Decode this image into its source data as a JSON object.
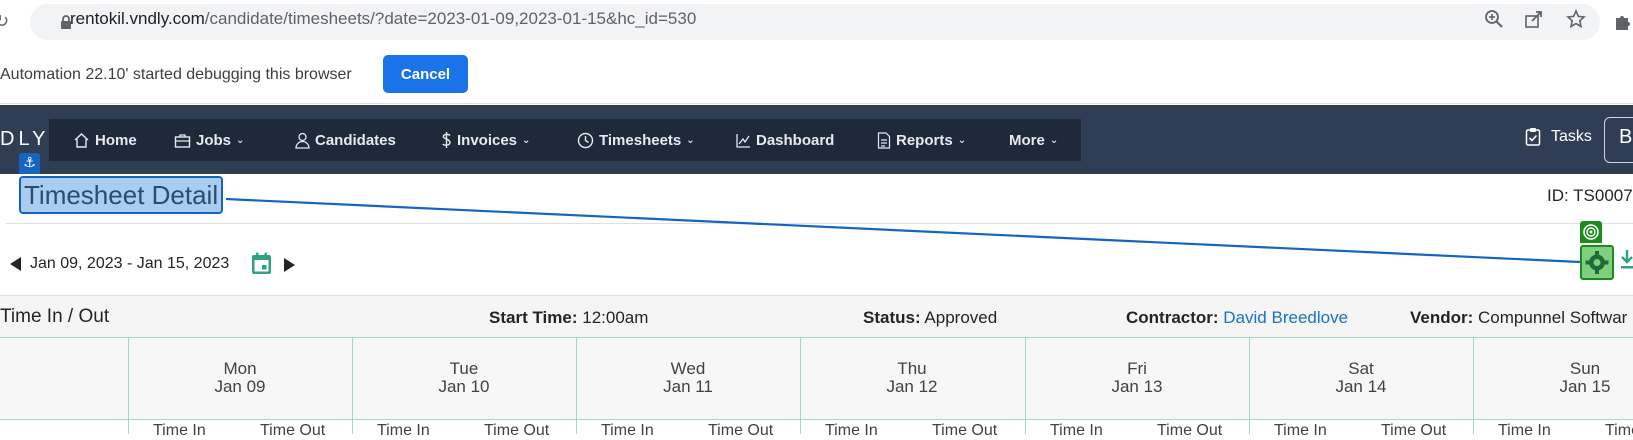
{
  "browser": {
    "url_host": "rentokil.vndly.com",
    "url_path": "/candidate/timesheets/?date=2023-01-09,2023-01-15&hc_id=530"
  },
  "debug_bar": {
    "message": "Automation 22.10' started debugging this browser",
    "cancel_label": "Cancel"
  },
  "navbar": {
    "brand": "DLY",
    "items": [
      {
        "label": "Home",
        "icon": "home-icon"
      },
      {
        "label": "Jobs",
        "icon": "briefcase-icon"
      },
      {
        "label": "Candidates",
        "icon": "person-icon"
      },
      {
        "label": "Invoices",
        "icon": "dollar-icon"
      },
      {
        "label": "Timesheets",
        "icon": "clock-icon"
      },
      {
        "label": "Dashboard",
        "icon": "chart-icon"
      },
      {
        "label": "Reports",
        "icon": "document-icon"
      },
      {
        "label": "More",
        "icon": ""
      }
    ],
    "tasks_label": "Tasks",
    "user_initial": "B"
  },
  "page": {
    "title": "Timesheet Detail",
    "id_label": "ID: TS0007",
    "date_range": "Jan 09, 2023 - Jan 15, 2023",
    "anchor_glyph": "⚓"
  },
  "info": {
    "section_title": "Time In / Out",
    "start_time_label": "Start Time:",
    "start_time_value": "12:00am",
    "status_label": "Status:",
    "status_value": "Approved",
    "contractor_label": "Contractor:",
    "contractor_value": "David Breedlove",
    "vendor_label": "Vendor:",
    "vendor_value": "Compunnel Softwar"
  },
  "days": [
    {
      "dow": "Mon",
      "date": "Jan 09"
    },
    {
      "dow": "Tue",
      "date": "Jan 10"
    },
    {
      "dow": "Wed",
      "date": "Jan 11"
    },
    {
      "dow": "Thu",
      "date": "Jan 12"
    },
    {
      "dow": "Fri",
      "date": "Jan 13"
    },
    {
      "dow": "Sat",
      "date": "Jan 14"
    },
    {
      "dow": "Sun",
      "date": "Jan 15"
    }
  ],
  "grid": {
    "time_in_label": "Time In",
    "time_out_label": "Time Out"
  },
  "colors": {
    "navbar": "#2f3e55",
    "accent_green": "#2fa37e",
    "highlight_blue": "#1565c0",
    "target_green": "#1b8c1b"
  }
}
